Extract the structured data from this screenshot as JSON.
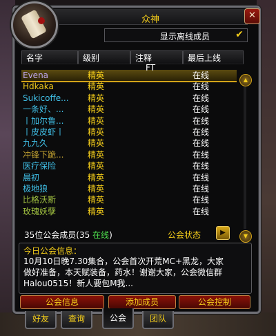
{
  "window": {
    "title": "众神",
    "close_label": "✕"
  },
  "show_offline": {
    "label": "显示离线成员",
    "checked_glyph": "✔"
  },
  "columns": [
    "名字",
    "级别",
    "注释",
    "最后上线"
  ],
  "members": [
    {
      "name": "Evena",
      "rank": "精英",
      "status": "在线",
      "name_color": "#c0a8f0",
      "selected": true
    },
    {
      "name": "Hdkaka",
      "rank": "精英",
      "status": "在线",
      "name_color": "#f4cd1a"
    },
    {
      "name": "Sukicoffe...",
      "rank": "精英",
      "status": "在线",
      "name_color": "#40c0e8"
    },
    {
      "name": "一条好、...",
      "rank": "精英",
      "status": "在线",
      "name_color": "#40c0e8"
    },
    {
      "name": "丨加尔鲁...",
      "rank": "精英",
      "status": "在线",
      "name_color": "#40c0e8"
    },
    {
      "name": "丨皮皮虾丨",
      "rank": "精英",
      "status": "在线",
      "name_color": "#40c0e8"
    },
    {
      "name": "九九久",
      "rank": "精英",
      "status": "在线",
      "name_color": "#40c0e8"
    },
    {
      "name": "冲锋下跪...",
      "rank": "精英",
      "status": "在线",
      "name_color": "#c0a030"
    },
    {
      "name": "医疗保险",
      "rank": "精英",
      "status": "在线",
      "name_color": "#40c0e8"
    },
    {
      "name": "晨初",
      "rank": "精英",
      "status": "在线",
      "name_color": "#40c0e8"
    },
    {
      "name": "极地狼",
      "rank": "精英",
      "status": "在线",
      "name_color": "#40c0e8"
    },
    {
      "name": "比格沃斯",
      "rank": "精英",
      "status": "在线",
      "name_color": "#a0c040"
    },
    {
      "name": "玫瑰妖孽",
      "rank": "精英",
      "status": "在线",
      "name_color": "#a0c040"
    }
  ],
  "cursor_text": "FT",
  "member_count": {
    "prefix": "35位公会成员(35 ",
    "online": "在线",
    "suffix": ")"
  },
  "guild_status_label": "公会状态",
  "motd": {
    "title": "今日公会信息：",
    "text": "10月10日晚7.30集合，公会首次开荒MC+黑龙，大家做好准备，本天赋装备，药水！谢谢大家，公会微信群Halou0515！新人要包M我..."
  },
  "buttons": {
    "info": "公会信息",
    "add": "添加成员",
    "control": "公会控制"
  },
  "tabs": [
    "好友",
    "查询",
    "公会",
    "团队"
  ],
  "colors": {
    "gold": "#f4cd1a",
    "online_green": "#4ee14e",
    "button_red": "#8a1208"
  }
}
